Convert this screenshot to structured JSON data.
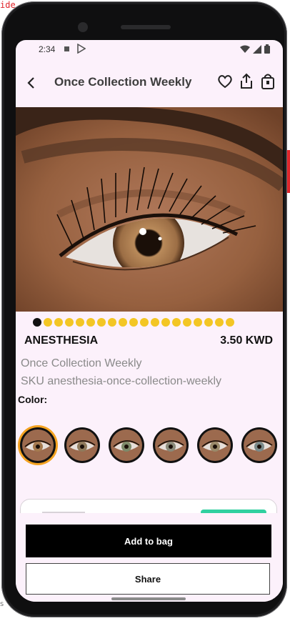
{
  "overlay": {
    "corner_text": "ide"
  },
  "status_bar": {
    "time": "2:34"
  },
  "app_bar": {
    "title": "Once Collection Weekly"
  },
  "product": {
    "name": "ANESTHESIA",
    "price": "3.50 KWD",
    "collection": "Once Collection Weekly",
    "sku": "SKU anesthesia-once-collection-weekly",
    "color_label": "Color:",
    "image_count": 19,
    "active_image": 1
  },
  "colors": {
    "accent": "#f3c624",
    "selected_ring": "#f4a321",
    "background": "#fcf1fb"
  },
  "actions": {
    "add_to_bag": "Add to bag",
    "share": "Share"
  }
}
